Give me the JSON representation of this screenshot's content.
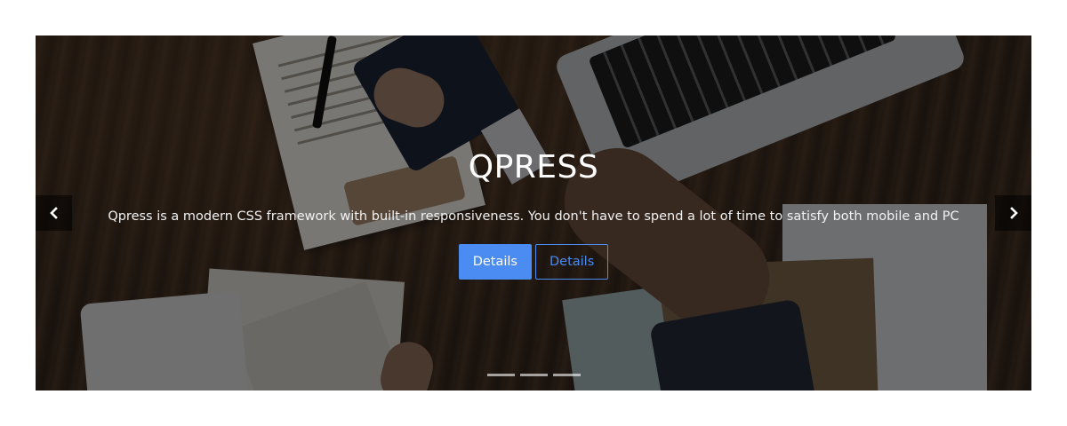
{
  "slide": {
    "title": "QPRESS",
    "description": "Qpress is a modern CSS framework with built-in responsiveness. You don't have to spend a lot of time to satisfy both mobile and PC",
    "primary_button_label": "Details",
    "secondary_button_label": "Details"
  },
  "controls": {
    "prev_icon": "chevron-left-icon",
    "next_icon": "chevron-right-icon",
    "indicator_count": 3
  },
  "colors": {
    "accent": "#4a8cf1",
    "overlay": "rgba(0,0,0,0.48)",
    "background": "#ffffff"
  }
}
